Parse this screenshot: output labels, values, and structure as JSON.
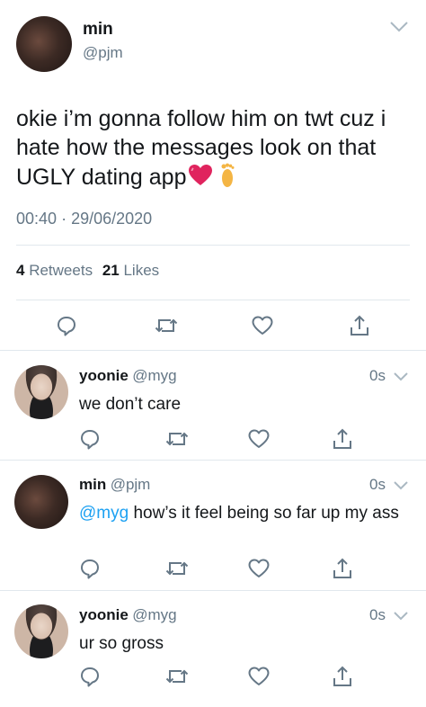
{
  "main_tweet": {
    "name": "min",
    "handle": "@pjm",
    "text": "okie i’m gonna follow him on twt cuz i hate how the messages look on that UGLY dating app",
    "emojis": [
      "heart-emoji",
      "foot-emoji"
    ],
    "time": "00:40",
    "date": "29/06/2020",
    "retweets_count": "4",
    "retweets_label": "Retweets",
    "likes_count": "21",
    "likes_label": "Likes"
  },
  "replies": [
    {
      "name": "yoonie",
      "handle": "@myg",
      "time": "0s",
      "text": "we don’t care"
    },
    {
      "name": "min",
      "handle": "@pjm",
      "time": "0s",
      "mention": "@myg",
      "text": "how’s it feel being so far up my ass"
    },
    {
      "name": "yoonie",
      "handle": "@myg",
      "time": "0s",
      "text": "ur so gross"
    }
  ],
  "colors": {
    "accent": "#1da1f2",
    "muted": "#657786",
    "divider": "#e1e8ed",
    "heart": "#e0245e"
  }
}
